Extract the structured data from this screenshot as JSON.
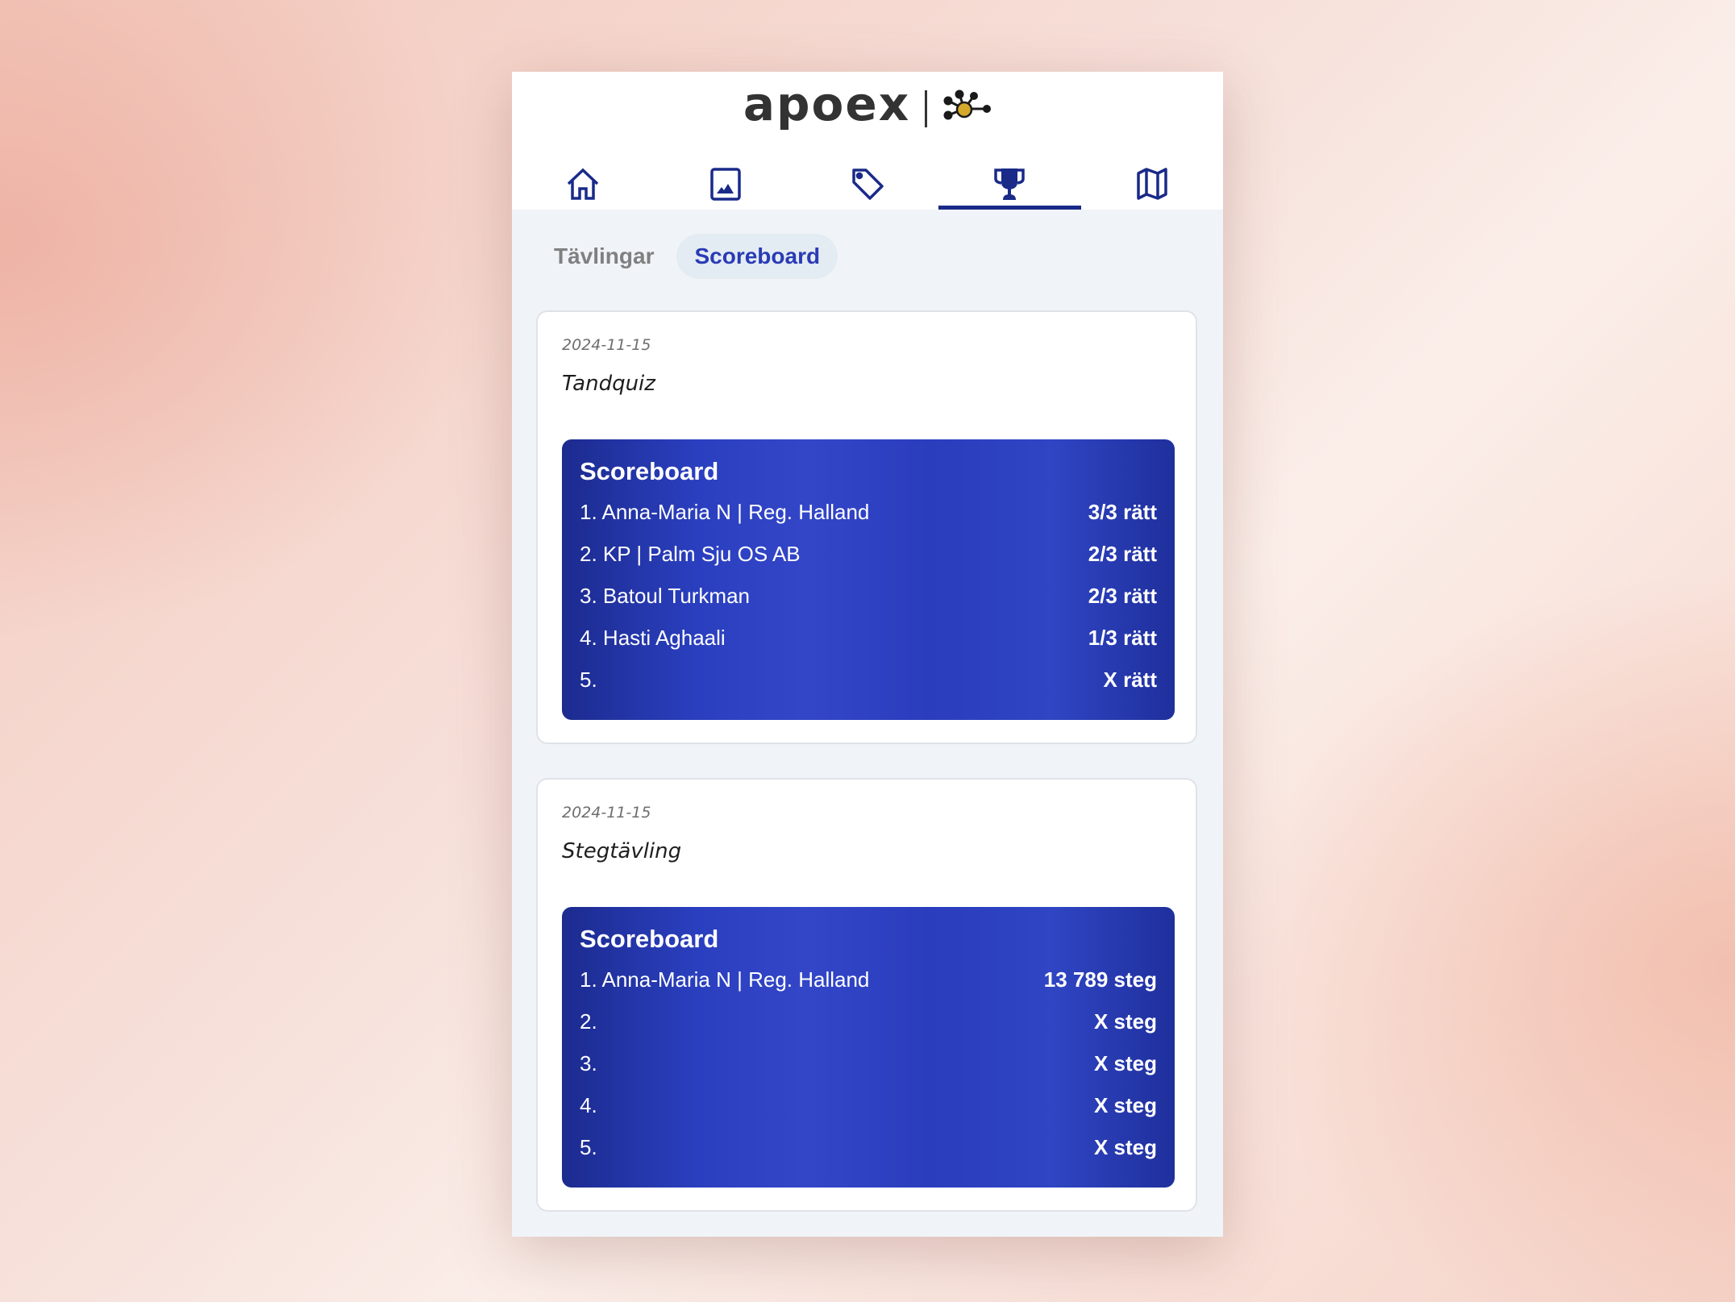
{
  "header": {
    "logo_text": "apoex",
    "logo_mark": "network-node-icon",
    "nav": [
      {
        "name": "home",
        "icon": "home-icon",
        "active": false
      },
      {
        "name": "gallery",
        "icon": "image-icon",
        "active": false
      },
      {
        "name": "offers",
        "icon": "tag-icon",
        "active": false
      },
      {
        "name": "competitions",
        "icon": "trophy-icon",
        "active": true
      },
      {
        "name": "map",
        "icon": "map-icon",
        "active": false
      }
    ]
  },
  "subtabs": [
    {
      "label": "Tävlingar",
      "active": false
    },
    {
      "label": "Scoreboard",
      "active": true
    }
  ],
  "colors": {
    "accent": "#1a2a88",
    "active_subtab": "#2a3bb5",
    "scoreboard_bg": "#2a3dbd"
  },
  "competitions": [
    {
      "date": "2024-11-15",
      "title": "Tandquiz",
      "scoreboard_title": "Scoreboard",
      "rows": [
        {
          "rank": "1.",
          "name": "Anna-Maria N | Reg. Halland",
          "score": "3/3 rätt"
        },
        {
          "rank": "2.",
          "name": "KP | Palm Sju OS AB",
          "score": "2/3 rätt"
        },
        {
          "rank": "3.",
          "name": "Batoul Turkman",
          "score": "2/3 rätt"
        },
        {
          "rank": "4.",
          "name": "Hasti Aghaali",
          "score": "1/3 rätt"
        },
        {
          "rank": "5.",
          "name": "",
          "score": "X rätt"
        }
      ]
    },
    {
      "date": "2024-11-15",
      "title": "Stegtävling",
      "scoreboard_title": "Scoreboard",
      "rows": [
        {
          "rank": "1.",
          "name": "Anna-Maria N | Reg. Halland",
          "score": "13 789 steg"
        },
        {
          "rank": "2.",
          "name": "",
          "score": "X steg"
        },
        {
          "rank": "3.",
          "name": "",
          "score": "X steg"
        },
        {
          "rank": "4.",
          "name": "",
          "score": "X steg"
        },
        {
          "rank": "5.",
          "name": "",
          "score": "X steg"
        }
      ]
    }
  ]
}
